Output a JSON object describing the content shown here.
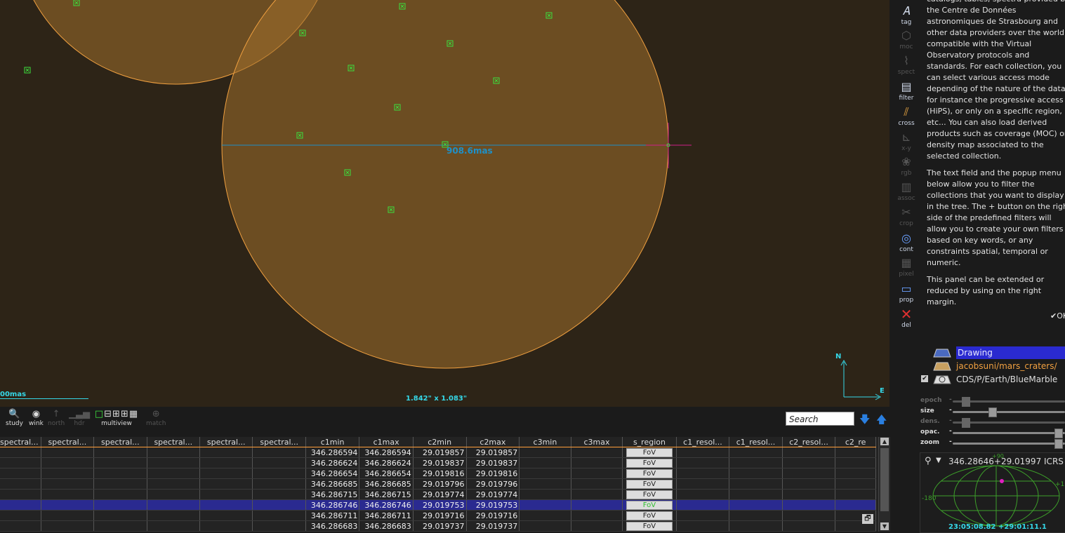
{
  "view": {
    "scale_label": "00mas",
    "fov_label": "1.842\" x 1.083\"",
    "measure_label": "908.6mas",
    "compass_n": "N",
    "compass_e": "E"
  },
  "colors": {
    "view_bg": "#2d2417",
    "region_fill": "#a0702c",
    "region_stroke": "#f0a040",
    "source_marker": "#3de03d",
    "accent": "#35d8e8",
    "selection": "#2a2a90"
  },
  "toolbar": [
    {
      "label": "tag",
      "icon": "tag-icon",
      "state": "on"
    },
    {
      "label": "moc",
      "icon": "moc-icon",
      "state": "off"
    },
    {
      "label": "spect",
      "icon": "spect-icon",
      "state": "off"
    },
    {
      "label": "filter",
      "icon": "filter-icon",
      "state": "on"
    },
    {
      "label": "cross",
      "icon": "cross-icon",
      "state": "on"
    },
    {
      "label": "x-y",
      "icon": "xy-icon",
      "state": "off"
    },
    {
      "label": "rgb",
      "icon": "rgb-icon",
      "state": "off"
    },
    {
      "label": "assoc",
      "icon": "assoc-icon",
      "state": "off"
    },
    {
      "label": "crop",
      "icon": "crop-icon",
      "state": "off"
    },
    {
      "label": "cont",
      "icon": "cont-icon",
      "state": "on"
    },
    {
      "label": "pixel",
      "icon": "pixel-icon",
      "state": "off"
    },
    {
      "label": "prop",
      "icon": "prop-icon",
      "state": "on"
    },
    {
      "label": "del",
      "icon": "del-icon",
      "state": "on"
    }
  ],
  "help": {
    "para1": "catalogs, tables, spectra provided by the Centre de Données astronomiques de Strasbourg and other data providers over the world compatible with the Virtual Observatory protocols and standards. For each collection, you can select various access mode depending of the nature of the data, for instance the progressive access (HiPS), or only on a specific region, etc... You can also load derived products such as coverage (MOC) or density map associated to the selected collection.",
    "para2": "The text field and the popup menu below allow you to filter the collections that you want to display in the tree. The + button on the righ side of the predefined filters will allow you to create your own filters based on key words, or any constraints spatial, temporal or numeric.",
    "para3": "This panel can be extended or reduced by using on the right margin.",
    "ok": "✔OK"
  },
  "layers": [
    {
      "label": "Drawing",
      "selected": true
    },
    {
      "label": "jacobsuni/mars_craters/",
      "selected": false
    },
    {
      "label": "CDS/P/Earth/BlueMarble",
      "selected": false
    }
  ],
  "sliders": [
    {
      "label": "epoch",
      "enabled": false,
      "value": 0.0
    },
    {
      "label": "size",
      "enabled": true,
      "value": 0.27
    },
    {
      "label": "dens.",
      "enabled": false,
      "value": 0.0
    },
    {
      "label": "opac.",
      "enabled": true,
      "value": 1.0
    },
    {
      "label": "zoom",
      "enabled": true,
      "value": 1.0
    }
  ],
  "locator": {
    "coord": "346.28646+29.01997 ICRS",
    "footer": "23:05:08.82 +29:01:11.1",
    "lon_left": "-180",
    "lon_right": "+1",
    "top_tick": "+90"
  },
  "bottom_tools": [
    {
      "label": "study",
      "icon": "study-icon",
      "state": "on"
    },
    {
      "label": "wink",
      "icon": "wink-icon",
      "state": "on"
    },
    {
      "label": "north",
      "icon": "north-icon",
      "state": "off"
    },
    {
      "label": "hdr",
      "icon": "hdr-icon",
      "state": "off"
    },
    {
      "label": "multiview",
      "icon": "multiview-icon",
      "state": "on"
    },
    {
      "label": "match",
      "icon": "match-icon",
      "state": "off"
    }
  ],
  "search": {
    "placeholder": "Search"
  },
  "table": {
    "columns": [
      "spectral...",
      "spectral...",
      "spectral...",
      "spectral...",
      "spectral...",
      "spectral...",
      "c1min",
      "c1max",
      "c2min",
      "c2max",
      "c3min",
      "c3max",
      "s_region",
      "c1_resol...",
      "c1_resol...",
      "c2_resol...",
      "c2_re"
    ],
    "rows": [
      {
        "c1min": "346.286594",
        "c1max": "346.286594",
        "c2min": "29.019857",
        "c2max": "29.019857",
        "sel": false
      },
      {
        "c1min": "346.286624",
        "c1max": "346.286624",
        "c2min": "29.019837",
        "c2max": "29.019837",
        "sel": false
      },
      {
        "c1min": "346.286654",
        "c1max": "346.286654",
        "c2min": "29.019816",
        "c2max": "29.019816",
        "sel": false
      },
      {
        "c1min": "346.286685",
        "c1max": "346.286685",
        "c2min": "29.019796",
        "c2max": "29.019796",
        "sel": false
      },
      {
        "c1min": "346.286715",
        "c1max": "346.286715",
        "c2min": "29.019774",
        "c2max": "29.019774",
        "sel": false
      },
      {
        "c1min": "346.286746",
        "c1max": "346.286746",
        "c2min": "29.019753",
        "c2max": "29.019753",
        "sel": true
      },
      {
        "c1min": "346.286711",
        "c1max": "346.286711",
        "c2min": "29.019716",
        "c2max": "29.019716",
        "sel": false
      },
      {
        "c1min": "346.286683",
        "c1max": "346.286683",
        "c2min": "29.019737",
        "c2max": "29.019737",
        "sel": false
      }
    ],
    "fov_label": "FoV"
  }
}
